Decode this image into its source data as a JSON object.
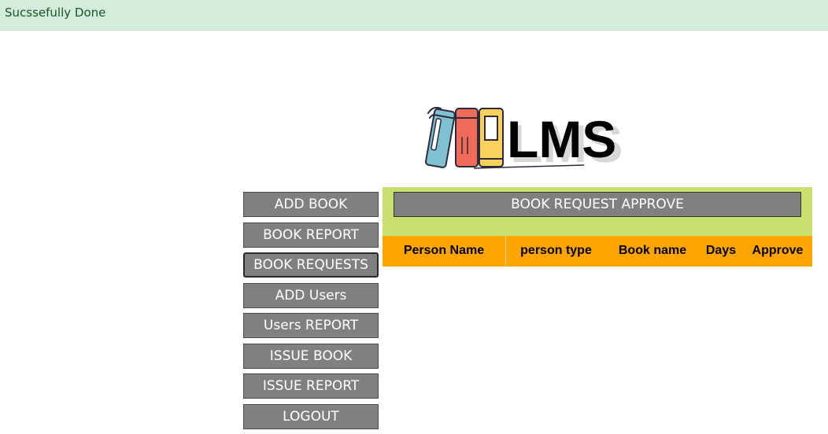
{
  "alert": {
    "message": "Sucssefully Done"
  },
  "logo": {
    "text": "LMS"
  },
  "menu": {
    "items": [
      {
        "label": "ADD BOOK",
        "active": false
      },
      {
        "label": "BOOK REPORT",
        "active": false
      },
      {
        "label": "BOOK REQUESTS",
        "active": true
      },
      {
        "label": "ADD Users",
        "active": false
      },
      {
        "label": "Users REPORT",
        "active": false
      },
      {
        "label": "ISSUE BOOK",
        "active": false
      },
      {
        "label": "ISSUE REPORT",
        "active": false
      },
      {
        "label": "LOGOUT",
        "active": false
      }
    ]
  },
  "panel": {
    "title": "BOOK REQUEST APPROVE"
  },
  "table": {
    "columns": [
      "Person Name",
      "person type",
      "Book name",
      "Days",
      "Approve"
    ],
    "rows": []
  },
  "colors": {
    "alert_bg": "#d4ecdc",
    "alert_text": "#155724",
    "button_bg": "#808080",
    "panel_bg": "#c8e06e",
    "table_header_bg": "#ffa500"
  }
}
